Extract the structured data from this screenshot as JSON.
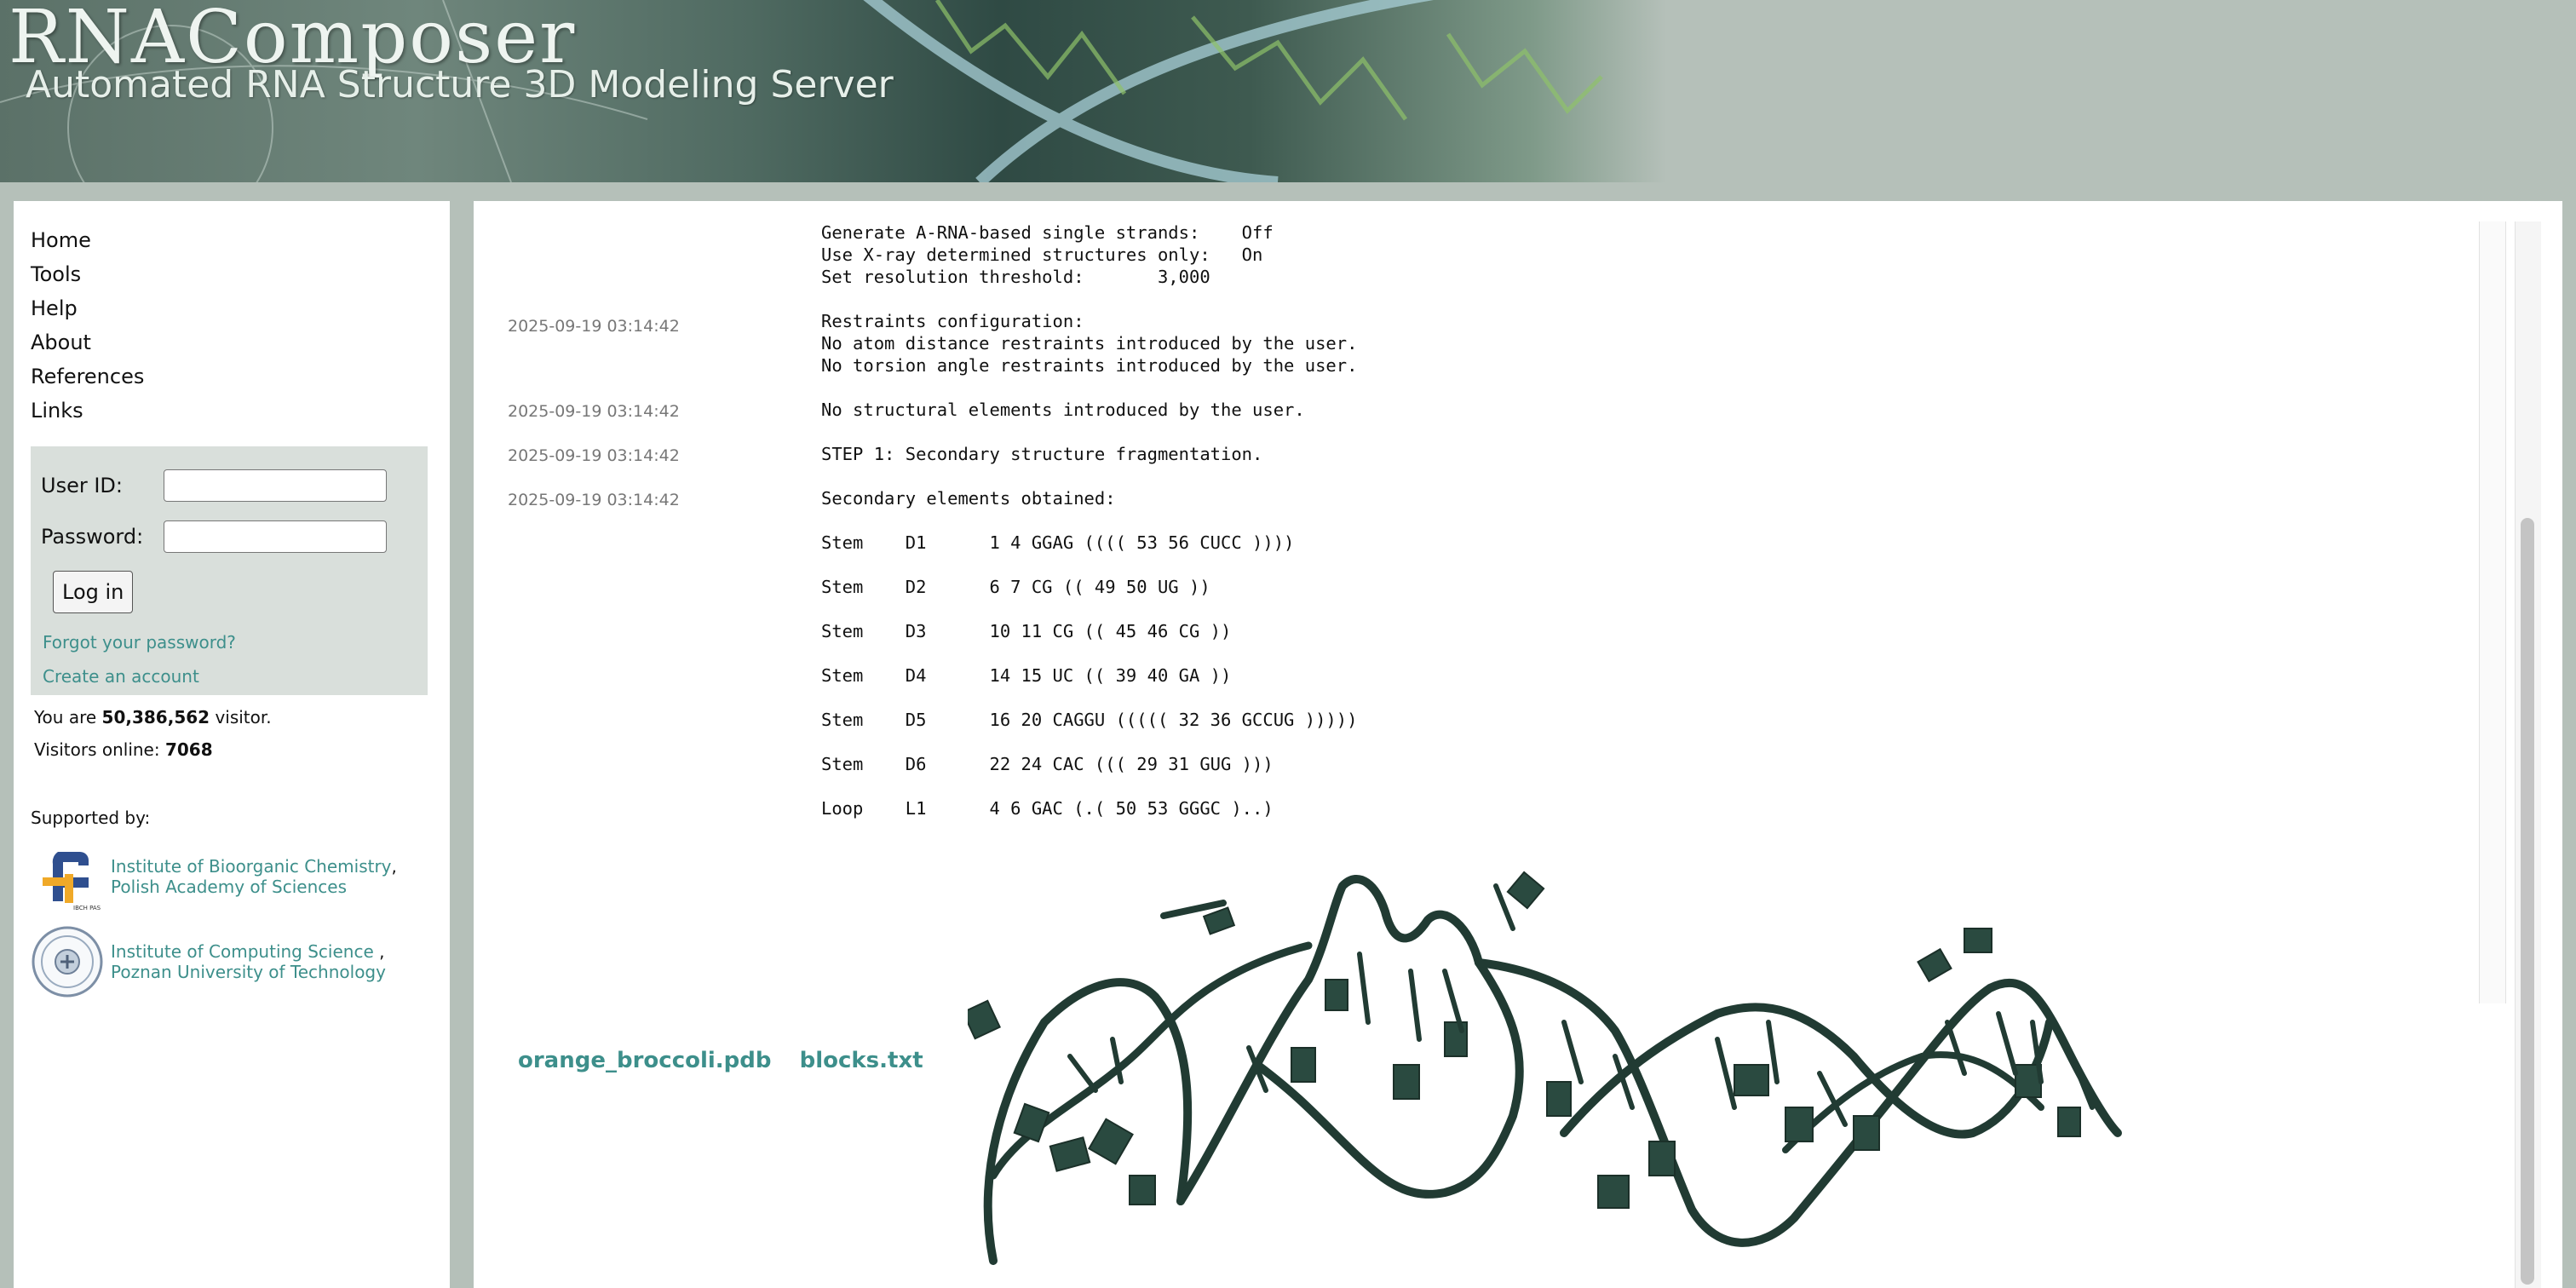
{
  "header": {
    "title": "RNAComposer",
    "subtitle": "Automated RNA Structure 3D Modeling Server"
  },
  "sidebar": {
    "nav": [
      "Home",
      "Tools",
      "Help",
      "About",
      "References",
      "Links"
    ],
    "login": {
      "user_label": "User ID:",
      "password_label": "Password:",
      "user_value": "",
      "password_value": "",
      "button": "Log in",
      "forgot": "Forgot your password?",
      "create": "Create an account"
    },
    "visitor": {
      "prefix": "You are",
      "count": "50,386,562",
      "suffix": "visitor."
    },
    "online": {
      "prefix": "Visitors online:",
      "count": "7068"
    },
    "supported_by": "Supported by:",
    "sponsors": [
      {
        "name": "Institute of Bioorganic Chemistry",
        "sep": ",",
        "parent": "Polish Academy of Sciences",
        "logo": "ibch-logo"
      },
      {
        "name": "Institute of Computing Science ",
        "sep": ",",
        "parent": "Poznan University of Technology",
        "logo": "put-seal-logo"
      }
    ]
  },
  "log": {
    "timestamps": [
      "2025-09-19 03:14:42",
      "2025-09-19 03:14:42",
      "2025-09-19 03:14:42",
      "2025-09-19 03:14:42"
    ],
    "text": "Generate A-RNA-based double helices:    Off\nGenerate A-RNA-based single strands:    Off\nUse X-ray determined structures only:   On\nSet resolution threshold:       3,000\n\nRestraints configuration:\nNo atom distance restraints introduced by the user.\nNo torsion angle restraints introduced by the user.\n\nNo structural elements introduced by the user.\n\nSTEP 1: Secondary structure fragmentation.\n\nSecondary elements obtained:\n\nStem    D1      1 4 GGAG (((( 53 56 CUCC ))))\n\nStem    D2      6 7 CG (( 49 50 UG ))\n\nStem    D3      10 11 CG (( 45 46 CG ))\n\nStem    D4      14 15 UC (( 39 40 GA ))\n\nStem    D5      16 20 CAGGU ((((( 32 36 GCCUG )))))\n\nStem    D6      22 24 CAC ((( 29 31 GUG )))\n\nLoop    L1      4 6 GAC (.( 50 53 GGGC )..)"
  },
  "downloads": [
    "orange_broccoli.pdb",
    "blocks.txt"
  ],
  "colors": {
    "accent": "#3d8f8b",
    "page_bg": "#b5c0b9",
    "rna": "#213b33"
  }
}
